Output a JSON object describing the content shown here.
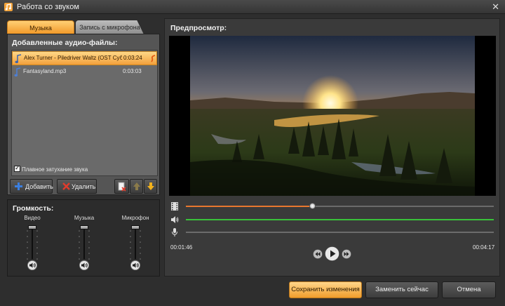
{
  "window": {
    "title": "Работа со звуком"
  },
  "tabs": [
    {
      "label": "Музыка",
      "active": true
    },
    {
      "label": "Запись с микрофона",
      "active": false
    }
  ],
  "audio_files": {
    "header": "Добавленные аудио-файлы:",
    "items": [
      {
        "name": "Alex Turner - Piledriver Waltz (OST Субмар...",
        "duration": "0:03:24",
        "selected": true
      },
      {
        "name": "Fantasyland.mp3",
        "duration": "0:03:03",
        "selected": false
      }
    ],
    "fade_label": "Плавное затухание звука",
    "fade_checked": true
  },
  "buttons": {
    "add": "Добавить",
    "delete": "Удалить",
    "save": "Сохранить изменения",
    "replace": "Заменить сейчас",
    "cancel": "Отмена"
  },
  "volume": {
    "header": "Громкость:",
    "channels": [
      {
        "label": "Видео",
        "level": 1.0
      },
      {
        "label": "Музыка",
        "level": 1.0
      },
      {
        "label": "Микрофон",
        "level": 1.0
      }
    ]
  },
  "preview": {
    "header": "Предпросмотр:",
    "current_time": "00:01:46",
    "total_time": "00:04:17",
    "video_progress": 0.41,
    "music_level": 1.0,
    "mic_level": 0.0
  },
  "colors": {
    "accent": "#f29a2a",
    "video_fill": "#e8772e",
    "music_fill": "#39c23a"
  },
  "icons": [
    "film-icon",
    "speaker-icon",
    "microphone-icon",
    "music-note-icon",
    "plus-icon",
    "close-x-icon",
    "file-delete-icon",
    "arrow-up-icon",
    "arrow-down-icon",
    "rewind-icon",
    "play-icon",
    "fast-forward-icon"
  ]
}
